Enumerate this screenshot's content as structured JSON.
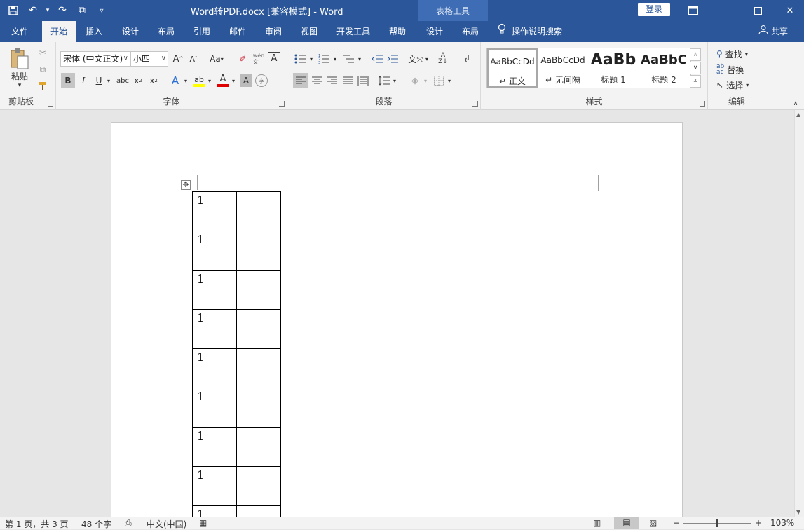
{
  "window": {
    "title": "Word转PDF.docx [兼容模式]  -  Word",
    "contextual_tab_group": "表格工具",
    "login_label": "登录"
  },
  "tabs": [
    {
      "label": "文件"
    },
    {
      "label": "开始"
    },
    {
      "label": "插入"
    },
    {
      "label": "设计"
    },
    {
      "label": "布局"
    },
    {
      "label": "引用"
    },
    {
      "label": "邮件"
    },
    {
      "label": "审阅"
    },
    {
      "label": "视图"
    },
    {
      "label": "开发工具"
    },
    {
      "label": "帮助"
    },
    {
      "label": "设计"
    },
    {
      "label": "布局"
    }
  ],
  "tell_me": "操作说明搜索",
  "share": "共享",
  "ribbon": {
    "clipboard": {
      "label": "剪贴板",
      "paste": "粘贴"
    },
    "font": {
      "label": "字体",
      "font_name": "宋体 (中文正文)",
      "font_size": "小四",
      "change_case": "Aa"
    },
    "paragraph": {
      "label": "段落"
    },
    "styles": {
      "label": "样式",
      "items": [
        {
          "sample": "AaBbCcDd",
          "name": "↵ 正文"
        },
        {
          "sample": "AaBbCcDd",
          "name": "↵ 无间隔"
        },
        {
          "sample": "AaBb",
          "name": "标题 1"
        },
        {
          "sample": "AaBbC",
          "name": "标题 2"
        }
      ]
    },
    "editing": {
      "label": "编辑",
      "find": "查找",
      "replace": "替换",
      "select": "选择"
    }
  },
  "document": {
    "table_rows": [
      "1",
      "1",
      "1",
      "1",
      "1",
      "1",
      "1",
      "1",
      "1"
    ]
  },
  "status": {
    "page": "第 1 页，共 3 页",
    "words": "48 个字",
    "language": "中文(中国)",
    "zoom": "103%"
  },
  "colors": {
    "brand": "#2b579a",
    "contextual": "#3e6db5",
    "ribbon": "#f3f3f3",
    "font_color": "#e00000",
    "highlight": "#ffff00"
  }
}
